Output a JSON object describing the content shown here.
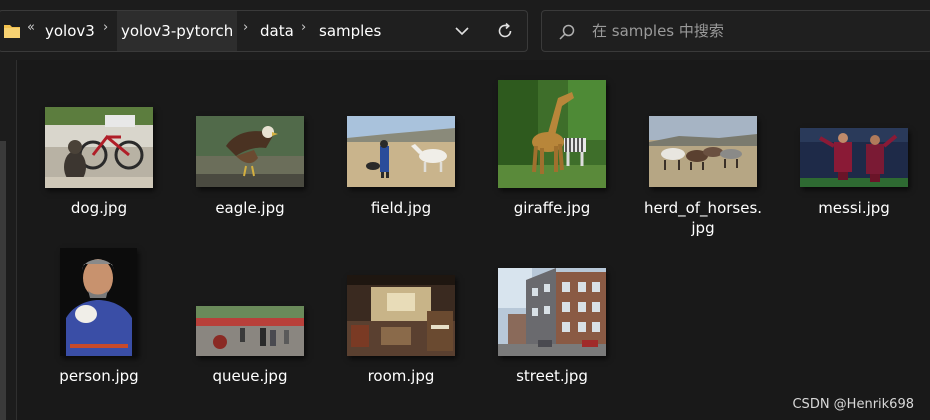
{
  "breadcrumb": {
    "overflow": "«",
    "items": [
      "yolov3",
      "yolov3-pytorch",
      "data",
      "samples"
    ]
  },
  "search": {
    "placeholder": "在 samples 中搜索"
  },
  "files": [
    {
      "name": "dog.jpg"
    },
    {
      "name": "eagle.jpg"
    },
    {
      "name": "field.jpg"
    },
    {
      "name": "giraffe.jpg"
    },
    {
      "name_line1": "herd_of_horses.",
      "name_line2": "jpg"
    },
    {
      "name": "messi.jpg"
    },
    {
      "name": "person.jpg"
    },
    {
      "name": "queue.jpg"
    },
    {
      "name": "room.jpg"
    },
    {
      "name": "street.jpg"
    }
  ],
  "watermark": "CSDN @Henrik698",
  "colors": {
    "background": "#191919",
    "folder": "#f2c14e",
    "text": "#ffffff"
  }
}
